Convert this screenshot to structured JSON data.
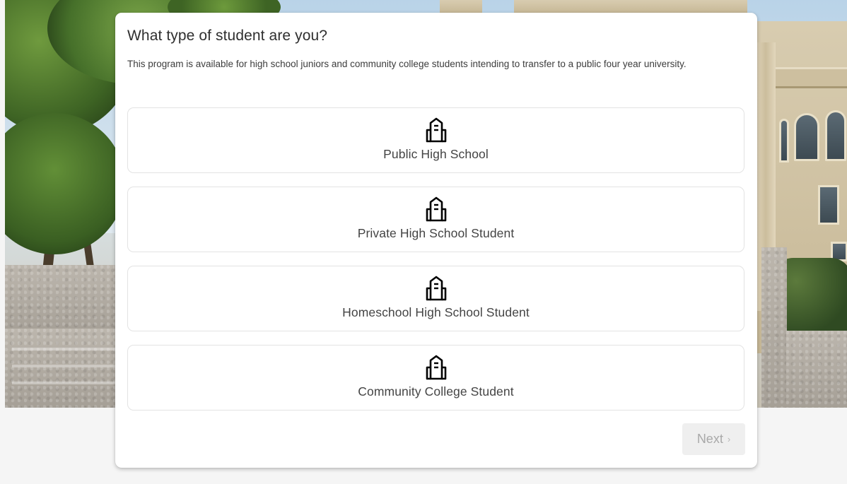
{
  "question": {
    "title": "What type of student are you?",
    "description": "This program is available for high school juniors and community college students intending to transfer to a public four year university."
  },
  "options": [
    {
      "label": "Public High School",
      "icon": "school-building-icon"
    },
    {
      "label": "Private High School Student",
      "icon": "school-building-icon"
    },
    {
      "label": "Homeschool High School Student",
      "icon": "school-building-icon"
    },
    {
      "label": "Community College Student",
      "icon": "school-building-icon"
    }
  ],
  "navigation": {
    "next_label": "Next",
    "next_icon": "chevron-right-icon",
    "next_enabled": false
  },
  "colors": {
    "card_background": "#ffffff",
    "option_border": "#e3e3e3",
    "disabled_button_background": "#efefef",
    "disabled_button_text": "#a9a9a9"
  }
}
